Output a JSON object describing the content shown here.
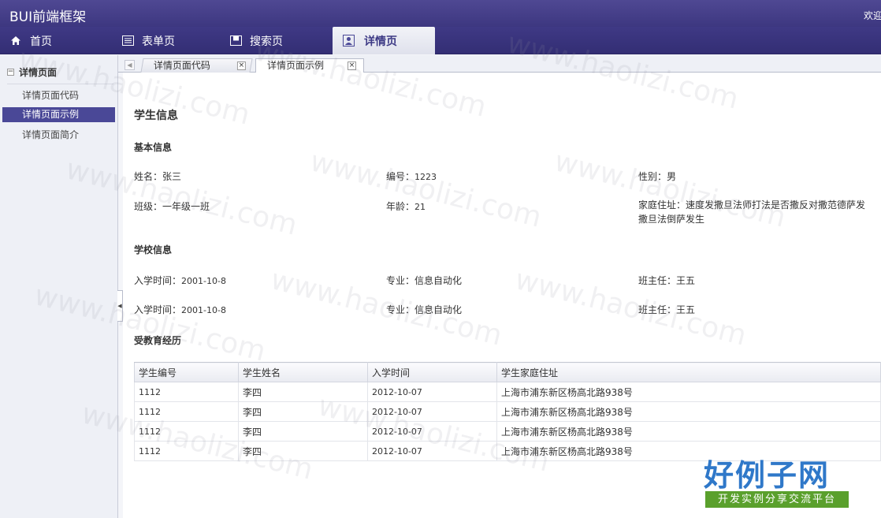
{
  "header": {
    "brand": "BUI前端框架",
    "welcome": "欢迎您"
  },
  "nav": {
    "items": [
      {
        "label": "首页",
        "icon": "home-icon"
      },
      {
        "label": "表单页",
        "icon": "form-icon"
      },
      {
        "label": "搜索页",
        "icon": "search-page-icon"
      },
      {
        "label": "详情页",
        "icon": "user-card-icon"
      }
    ],
    "active": "详情页"
  },
  "sidebar": {
    "title": "详情页面",
    "items": [
      {
        "label": "详情页面代码"
      },
      {
        "label": "详情页面示例"
      },
      {
        "label": "详情页面简介"
      }
    ],
    "active": "详情页面示例"
  },
  "tabs": [
    {
      "label": "详情页面代码"
    },
    {
      "label": "详情页面示例"
    }
  ],
  "content": {
    "title": "学生信息",
    "basic": {
      "heading": "基本信息",
      "name_label": "姓名：",
      "name": "张三",
      "id_label": "编号：",
      "id": "1223",
      "gender_label": "性别：",
      "gender": "男",
      "class_label": "班级：",
      "class": "一年级一班",
      "age_label": "年龄：",
      "age": "21",
      "address_label": "家庭住址：",
      "address": "速度发撒旦法师打法是否撒反对撒范德萨发撒旦法倒萨发生"
    },
    "school": {
      "heading": "学校信息",
      "rows": [
        {
          "enroll_label": "入学时间：",
          "enroll": "2001-10-8",
          "major_label": "专业：",
          "major": "信息自动化",
          "teacher_label": "班主任：",
          "teacher": "王五"
        },
        {
          "enroll_label": "入学时间：",
          "enroll": "2001-10-8",
          "major_label": "专业：",
          "major": "信息自动化",
          "teacher_label": "班主任：",
          "teacher": "王五"
        }
      ]
    },
    "education": {
      "heading": "受教育经历",
      "columns": [
        "学生编号",
        "学生姓名",
        "入学时间",
        "学生家庭住址"
      ],
      "rows": [
        [
          "1112",
          "李四",
          "2012-10-07",
          "上海市浦东新区杨高北路938号"
        ],
        [
          "1112",
          "李四",
          "2012-10-07",
          "上海市浦东新区杨高北路938号"
        ],
        [
          "1112",
          "李四",
          "2012-10-07",
          "上海市浦东新区杨高北路938号"
        ],
        [
          "1112",
          "李四",
          "2012-10-07",
          "上海市浦东新区杨高北路938号"
        ]
      ]
    }
  },
  "watermark": {
    "text": "www.haolizi.com",
    "logo_main": "好例子网",
    "logo_sub": "开发实例分享交流平台"
  },
  "colors": {
    "header": "#3d3780",
    "active_side": "#4a4897",
    "logo_blue": "#2f78c9",
    "logo_green": "#5aa02c"
  }
}
